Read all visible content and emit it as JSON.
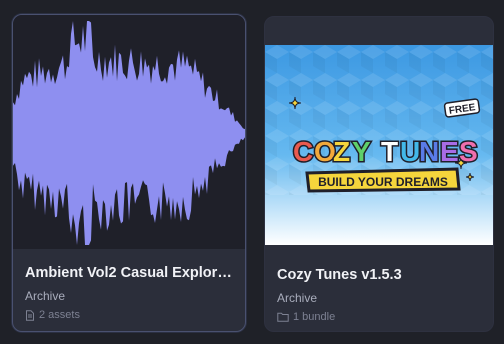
{
  "cards": [
    {
      "title": "Ambient Vol2 Casual Explorat...",
      "type": "Archive",
      "meta": "2 assets",
      "meta_icon": "document-icon",
      "thumbnail": "waveform"
    },
    {
      "title": "Cozy Tunes v1.5.3",
      "type": "Archive",
      "meta": "1 bundle",
      "meta_icon": "folder-icon",
      "thumbnail": "logo",
      "logo": {
        "badge": "FREE",
        "word1": "COZY",
        "word2": "TUNES",
        "tagline": "BUILD YOUR DREAMS"
      }
    }
  ],
  "colors": {
    "page_bg": "#1f2128",
    "card_bg": "#2b2e3a",
    "waveform": "#8e8ff0",
    "thumbnail_sky": "#4fa6e6"
  }
}
